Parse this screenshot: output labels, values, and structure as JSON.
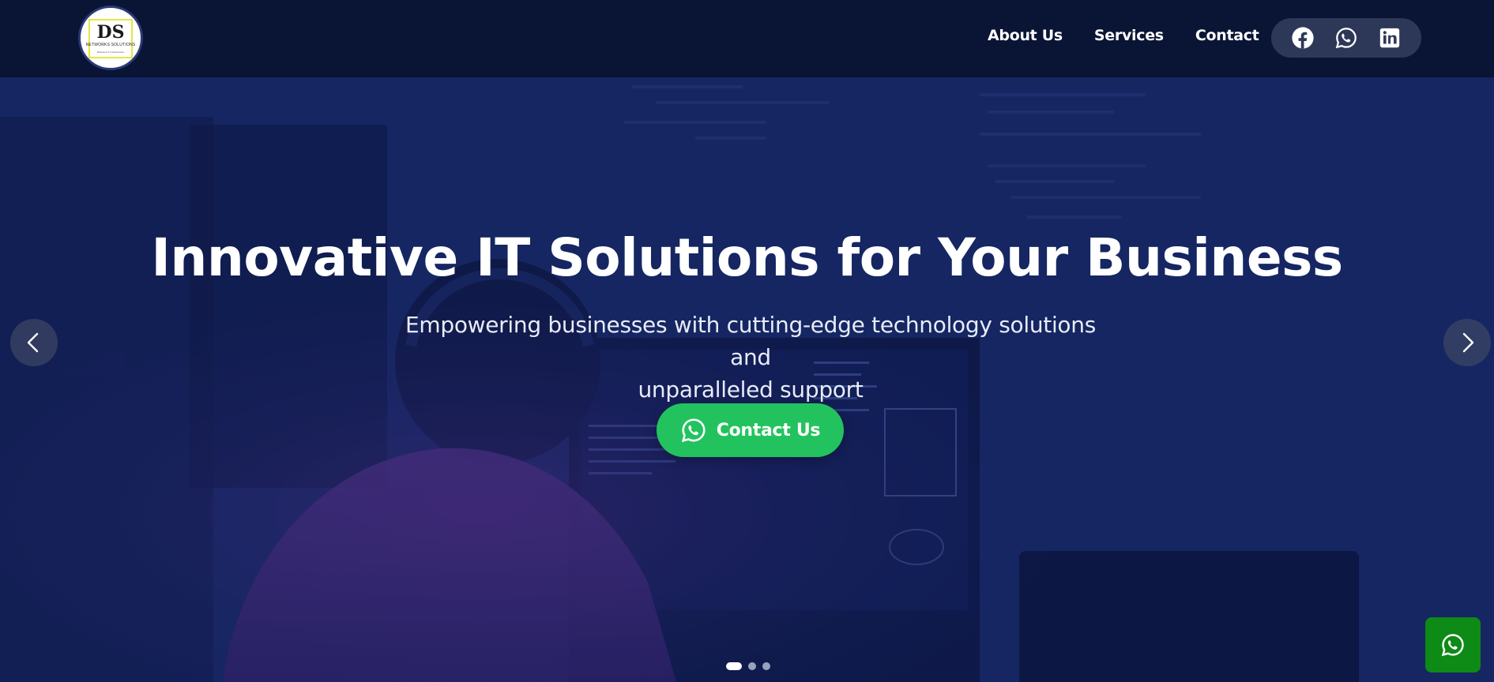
{
  "brand": {
    "logo_text": "DS",
    "logo_subtext": "NETWORKS SOLUTIONS",
    "logo_tagline": "Business IT Infrastructure"
  },
  "nav": {
    "items": [
      {
        "label": "About Us"
      },
      {
        "label": "Services"
      },
      {
        "label": "Contact"
      }
    ]
  },
  "social": {
    "icons": [
      "facebook-icon",
      "whatsapp-icon",
      "linkedin-icon"
    ]
  },
  "hero": {
    "title": "Innovative IT Solutions for Your Business",
    "subtitle_line1": "Empowering businesses with cutting-edge technology solutions and",
    "subtitle_line2": "unparalleled support",
    "cta_label": "Contact Us",
    "slide_count": 3,
    "active_slide": 1
  },
  "colors": {
    "header_bg": "#0a1434",
    "hero_tint": "#15265f",
    "cta_green": "#22c35e",
    "wa_float_green": "#0e8a16",
    "social_pill": "#2d3858"
  }
}
